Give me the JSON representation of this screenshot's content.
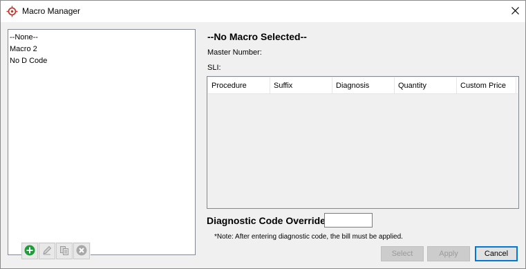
{
  "window": {
    "title": "Macro Manager",
    "icons": {
      "app": "crosshair-app-icon",
      "close": "close-icon"
    }
  },
  "macro_list": {
    "items": [
      "--None--",
      "Macro 2",
      "No D Code"
    ],
    "toolbar_icons": [
      "add-icon",
      "edit-icon",
      "copy-icon",
      "delete-icon"
    ],
    "add_color": "#1e9e3a"
  },
  "detail": {
    "heading": "--No Macro Selected--",
    "master_number_label": "Master Number:",
    "sli_label": "SLI:",
    "columns": [
      "Procedure",
      "Suffix",
      "Diagnosis",
      "Quantity",
      "Custom Price"
    ],
    "rows": []
  },
  "override": {
    "label": "Diagnostic Code Override:",
    "value": "",
    "note": "*Note: After entering diagnostic code, the bill must be applied."
  },
  "buttons": {
    "select": "Select",
    "apply": "Apply",
    "cancel": "Cancel"
  },
  "colors": {
    "accent": "#c8372d",
    "focus": "#0078d7"
  }
}
